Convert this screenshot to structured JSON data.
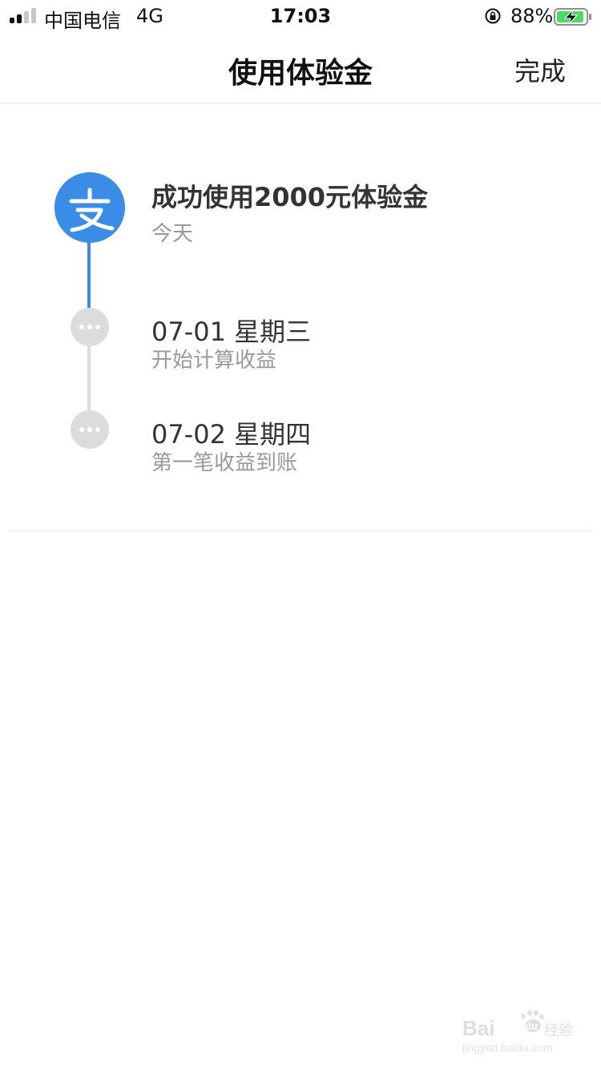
{
  "status_bar": {
    "carrier": "中国电信",
    "network": "4G",
    "time": "17:03",
    "battery_percent": "88%",
    "signal_bars_filled": 2,
    "signal_bars_total": 4,
    "battery_level": 0.88,
    "charging": true,
    "icons": [
      "signal-icon",
      "rotation-lock-icon",
      "battery-charging-icon"
    ]
  },
  "nav": {
    "title": "使用体验金",
    "done_label": "完成"
  },
  "timeline": {
    "steps": [
      {
        "title": "成功使用2000元体验金",
        "subtitle": "今天",
        "icon": "alipay-logo-icon"
      },
      {
        "title": "07-01 星期三",
        "subtitle": "开始计算收益",
        "icon": "more-dots-icon"
      },
      {
        "title": "07-02 星期四",
        "subtitle": "第一笔收益到账",
        "icon": "more-dots-icon"
      }
    ],
    "logo_char": "支"
  },
  "colors": {
    "accent_blue": "#3b8ce6",
    "pending_gray": "#dcdcdc",
    "battery_green": "#4cd964"
  },
  "watermark": {
    "brand": "Baidu经验",
    "url": "jingyan.baidu.com"
  }
}
